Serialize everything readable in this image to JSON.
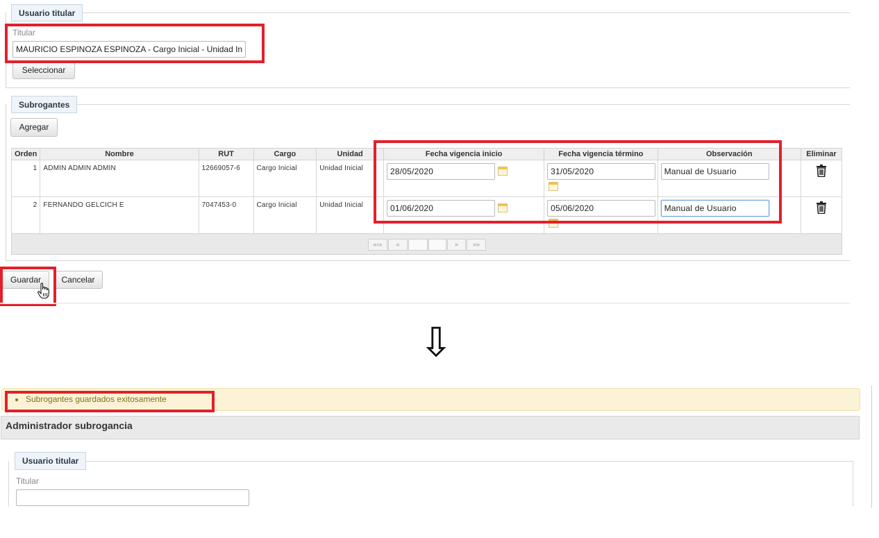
{
  "before": {
    "titular_legend": "Usuario titular",
    "titular_label": "Titular",
    "titular_value": "MAURICIO ESPINOZA ESPINOZA - Cargo Inicial - Unidad In",
    "select_button": "Seleccionar",
    "subrogantes_legend": "Subrogantes",
    "add_button": "Agregar",
    "columns": [
      "Orden",
      "Nombre",
      "RUT",
      "Cargo",
      "Unidad",
      "Fecha vigencia inicio",
      "Fecha vigencia término",
      "Observación",
      "Eliminar"
    ],
    "rows": [
      {
        "orden": "1",
        "nombre": "ADMIN ADMIN ADMIN",
        "rut": "12669057-6",
        "cargo": "Cargo Inicial",
        "unidad": "Unidad Inicial",
        "inicio": "28/05/2020",
        "termino": "31/05/2020",
        "observacion": "Manual de Usuario"
      },
      {
        "orden": "2",
        "nombre": "FERNANDO GELCICH E",
        "rut": "7047453-0",
        "cargo": "Cargo Inicial",
        "unidad": "Unidad Inicial",
        "inicio": "01/06/2020",
        "termino": "05/06/2020",
        "observacion": "Manual de Usuario"
      }
    ],
    "pager": {
      "first": "«‹«",
      "prev": "«",
      "next": "»",
      "last": "»»"
    },
    "save_button": "Guardar",
    "cancel_button": "Cancelar"
  },
  "arrow": "⇩",
  "after": {
    "success_message": "Subrogantes guardados exitosamente",
    "panel_title": "Administrador subrogancia",
    "titular_legend": "Usuario titular",
    "titular_label": "Titular",
    "titular_value": ""
  },
  "colors": {
    "highlight": "#e2202b",
    "success_bg": "#fcf3d6",
    "success_text": "#8a6d1e"
  }
}
